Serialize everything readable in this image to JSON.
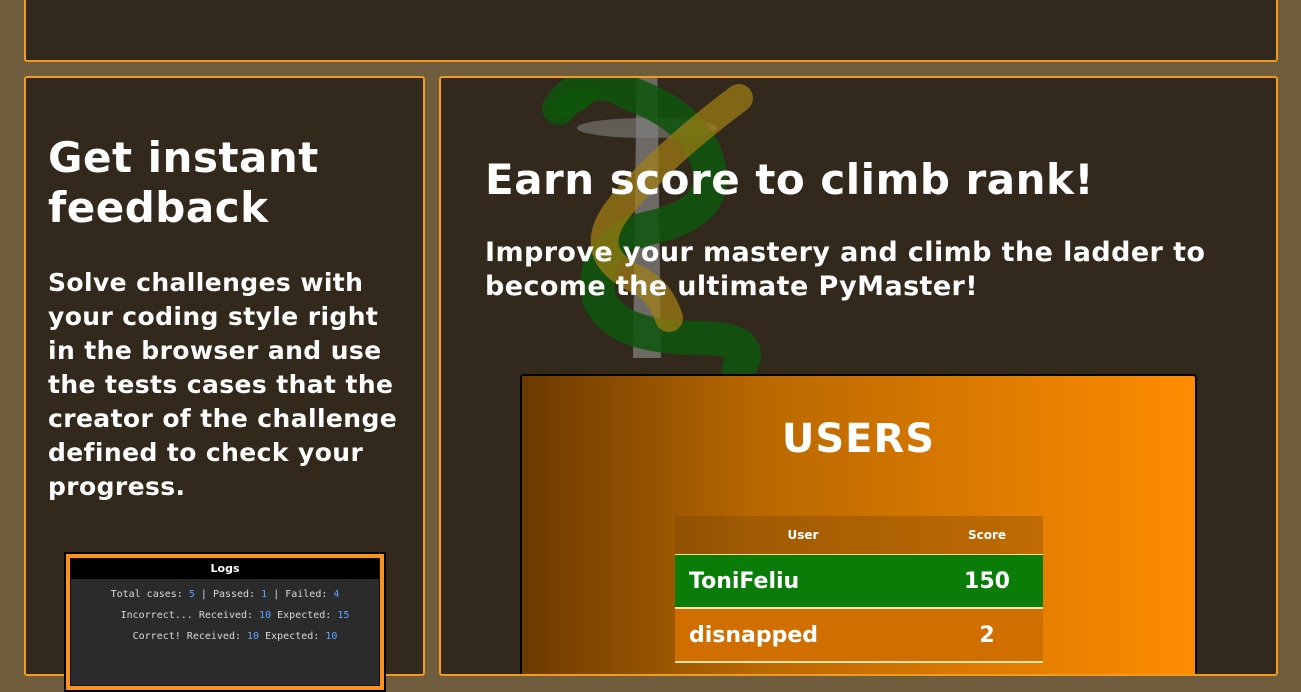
{
  "left_panel": {
    "title": "Get instant feedback",
    "text": "Solve challenges with your coding style right in the browser and use the tests cases that the creator of the challenge defined to check your progress.",
    "logs": {
      "header": "Logs",
      "line1": {
        "total_label": "Total cases:",
        "total": "5",
        "passed_label": "| Passed:",
        "passed": "1",
        "failed_label": "| Failed:",
        "failed": "4"
      },
      "line2": {
        "prefix": "Incorrect... Received:",
        "received": "10",
        "expected_label": "Expected:",
        "expected": "15"
      },
      "line3": {
        "prefix": "Correct! Received:",
        "received": "10",
        "expected_label": "Expected:",
        "expected": "10"
      }
    }
  },
  "right_panel": {
    "title": "Earn score to climb rank!",
    "text": "Improve your mastery and climb the ladder to become the ultimate PyMaster!",
    "users_card": {
      "title": "USERS",
      "columns": {
        "user": "User",
        "score": "Score"
      },
      "rows": [
        {
          "user": "ToniFeliu",
          "score": "150"
        },
        {
          "user": "disnapped",
          "score": "2"
        }
      ]
    }
  },
  "colors": {
    "background": "#6f5d3e",
    "panel": "#32291c",
    "panel_border": "#f19a1c",
    "first_row": "#0a7d08",
    "accent_orange": "#ff8c00"
  }
}
